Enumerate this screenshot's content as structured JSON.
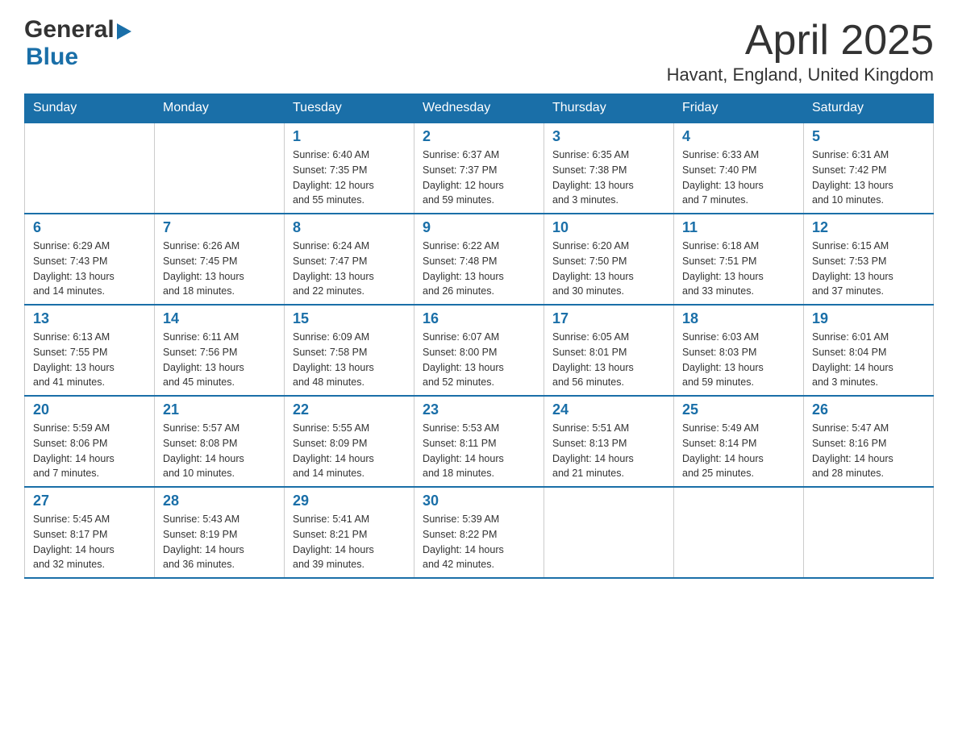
{
  "header": {
    "logo_general": "General",
    "logo_blue": "Blue",
    "title": "April 2025",
    "location": "Havant, England, United Kingdom"
  },
  "weekdays": [
    "Sunday",
    "Monday",
    "Tuesday",
    "Wednesday",
    "Thursday",
    "Friday",
    "Saturday"
  ],
  "weeks": [
    [
      {
        "day": "",
        "info": ""
      },
      {
        "day": "",
        "info": ""
      },
      {
        "day": "1",
        "info": "Sunrise: 6:40 AM\nSunset: 7:35 PM\nDaylight: 12 hours\nand 55 minutes."
      },
      {
        "day": "2",
        "info": "Sunrise: 6:37 AM\nSunset: 7:37 PM\nDaylight: 12 hours\nand 59 minutes."
      },
      {
        "day": "3",
        "info": "Sunrise: 6:35 AM\nSunset: 7:38 PM\nDaylight: 13 hours\nand 3 minutes."
      },
      {
        "day": "4",
        "info": "Sunrise: 6:33 AM\nSunset: 7:40 PM\nDaylight: 13 hours\nand 7 minutes."
      },
      {
        "day": "5",
        "info": "Sunrise: 6:31 AM\nSunset: 7:42 PM\nDaylight: 13 hours\nand 10 minutes."
      }
    ],
    [
      {
        "day": "6",
        "info": "Sunrise: 6:29 AM\nSunset: 7:43 PM\nDaylight: 13 hours\nand 14 minutes."
      },
      {
        "day": "7",
        "info": "Sunrise: 6:26 AM\nSunset: 7:45 PM\nDaylight: 13 hours\nand 18 minutes."
      },
      {
        "day": "8",
        "info": "Sunrise: 6:24 AM\nSunset: 7:47 PM\nDaylight: 13 hours\nand 22 minutes."
      },
      {
        "day": "9",
        "info": "Sunrise: 6:22 AM\nSunset: 7:48 PM\nDaylight: 13 hours\nand 26 minutes."
      },
      {
        "day": "10",
        "info": "Sunrise: 6:20 AM\nSunset: 7:50 PM\nDaylight: 13 hours\nand 30 minutes."
      },
      {
        "day": "11",
        "info": "Sunrise: 6:18 AM\nSunset: 7:51 PM\nDaylight: 13 hours\nand 33 minutes."
      },
      {
        "day": "12",
        "info": "Sunrise: 6:15 AM\nSunset: 7:53 PM\nDaylight: 13 hours\nand 37 minutes."
      }
    ],
    [
      {
        "day": "13",
        "info": "Sunrise: 6:13 AM\nSunset: 7:55 PM\nDaylight: 13 hours\nand 41 minutes."
      },
      {
        "day": "14",
        "info": "Sunrise: 6:11 AM\nSunset: 7:56 PM\nDaylight: 13 hours\nand 45 minutes."
      },
      {
        "day": "15",
        "info": "Sunrise: 6:09 AM\nSunset: 7:58 PM\nDaylight: 13 hours\nand 48 minutes."
      },
      {
        "day": "16",
        "info": "Sunrise: 6:07 AM\nSunset: 8:00 PM\nDaylight: 13 hours\nand 52 minutes."
      },
      {
        "day": "17",
        "info": "Sunrise: 6:05 AM\nSunset: 8:01 PM\nDaylight: 13 hours\nand 56 minutes."
      },
      {
        "day": "18",
        "info": "Sunrise: 6:03 AM\nSunset: 8:03 PM\nDaylight: 13 hours\nand 59 minutes."
      },
      {
        "day": "19",
        "info": "Sunrise: 6:01 AM\nSunset: 8:04 PM\nDaylight: 14 hours\nand 3 minutes."
      }
    ],
    [
      {
        "day": "20",
        "info": "Sunrise: 5:59 AM\nSunset: 8:06 PM\nDaylight: 14 hours\nand 7 minutes."
      },
      {
        "day": "21",
        "info": "Sunrise: 5:57 AM\nSunset: 8:08 PM\nDaylight: 14 hours\nand 10 minutes."
      },
      {
        "day": "22",
        "info": "Sunrise: 5:55 AM\nSunset: 8:09 PM\nDaylight: 14 hours\nand 14 minutes."
      },
      {
        "day": "23",
        "info": "Sunrise: 5:53 AM\nSunset: 8:11 PM\nDaylight: 14 hours\nand 18 minutes."
      },
      {
        "day": "24",
        "info": "Sunrise: 5:51 AM\nSunset: 8:13 PM\nDaylight: 14 hours\nand 21 minutes."
      },
      {
        "day": "25",
        "info": "Sunrise: 5:49 AM\nSunset: 8:14 PM\nDaylight: 14 hours\nand 25 minutes."
      },
      {
        "day": "26",
        "info": "Sunrise: 5:47 AM\nSunset: 8:16 PM\nDaylight: 14 hours\nand 28 minutes."
      }
    ],
    [
      {
        "day": "27",
        "info": "Sunrise: 5:45 AM\nSunset: 8:17 PM\nDaylight: 14 hours\nand 32 minutes."
      },
      {
        "day": "28",
        "info": "Sunrise: 5:43 AM\nSunset: 8:19 PM\nDaylight: 14 hours\nand 36 minutes."
      },
      {
        "day": "29",
        "info": "Sunrise: 5:41 AM\nSunset: 8:21 PM\nDaylight: 14 hours\nand 39 minutes."
      },
      {
        "day": "30",
        "info": "Sunrise: 5:39 AM\nSunset: 8:22 PM\nDaylight: 14 hours\nand 42 minutes."
      },
      {
        "day": "",
        "info": ""
      },
      {
        "day": "",
        "info": ""
      },
      {
        "day": "",
        "info": ""
      }
    ]
  ]
}
